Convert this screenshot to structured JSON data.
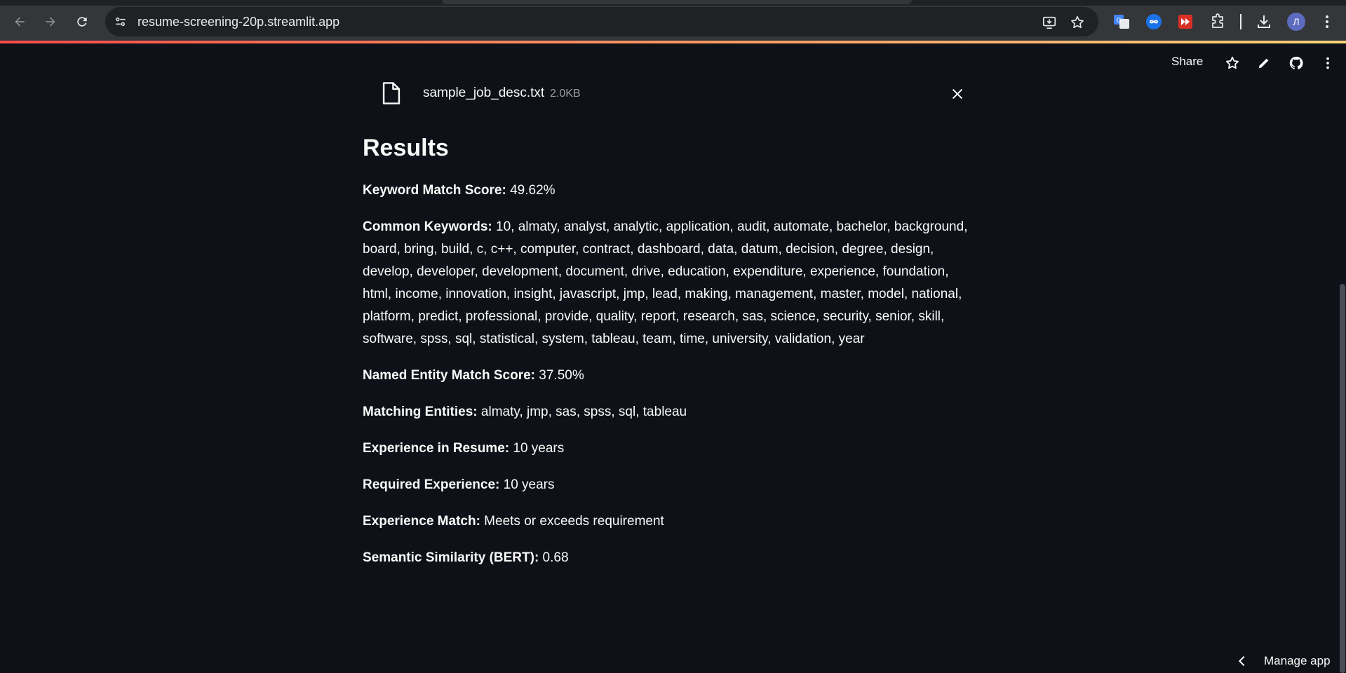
{
  "browser": {
    "url": "resume-screening-20p.streamlit.app",
    "profile_initial": "Л"
  },
  "header": {
    "share_label": "Share"
  },
  "uploaded_file": {
    "name": "sample_job_desc.txt",
    "size": "2.0KB"
  },
  "results": {
    "title": "Results",
    "items": [
      {
        "label": "Keyword Match Score:",
        "value": " 49.62%"
      },
      {
        "label": "Common Keywords:",
        "value": " 10, almaty, analyst, analytic, application, audit, automate, bachelor, background, board, bring, build, c, c++, computer, contract, dashboard, data, datum, decision, degree, design, develop, developer, development, document, drive, education, expenditure, experience, foundation, html, income, innovation, insight, javascript, jmp, lead, making, management, master, model, national, platform, predict, professional, provide, quality, report, research, sas, science, security, senior, skill, software, spss, sql, statistical, system, tableau, team, time, university, validation, year"
      },
      {
        "label": "Named Entity Match Score:",
        "value": " 37.50%"
      },
      {
        "label": "Matching Entities:",
        "value": " almaty, jmp, sas, spss, sql, tableau"
      },
      {
        "label": "Experience in Resume:",
        "value": " 10 years"
      },
      {
        "label": "Required Experience:",
        "value": " 10 years"
      },
      {
        "label": "Experience Match:",
        "value": " Meets or exceeds requirement"
      },
      {
        "label": "Semantic Similarity (BERT):",
        "value": " 0.68"
      }
    ]
  },
  "footer": {
    "manage_app_label": "Manage app"
  },
  "colors": {
    "background": "#0e1117",
    "text": "#fafafa",
    "muted": "#9a9ca3",
    "chrome": "#35363a"
  }
}
